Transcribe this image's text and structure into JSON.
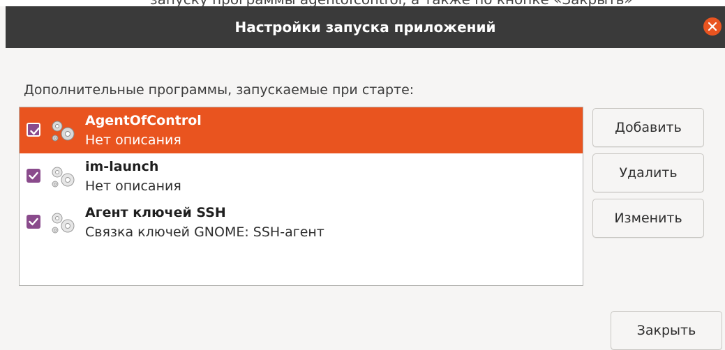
{
  "top_strip_text": "запуску программы agentofcontrol, а также по кнопке «Закрыть»",
  "window": {
    "title": "Настройки запуска приложений",
    "close_icon": "close-icon"
  },
  "section_label": "Дополнительные программы, запускаемые при старте:",
  "startup_items": [
    {
      "name": "AgentOfControl",
      "description": "Нет описания",
      "checked": true,
      "selected": true
    },
    {
      "name": "im-launch",
      "description": "Нет описания",
      "checked": true,
      "selected": false
    },
    {
      "name": "Агент ключей SSH",
      "description": "Связка ключей GNOME: SSH-агент",
      "checked": true,
      "selected": false
    }
  ],
  "buttons": {
    "add": "Добавить",
    "remove": "Удалить",
    "edit": "Изменить",
    "close": "Закрыть"
  },
  "colors": {
    "accent": "#e9541f",
    "checkbox": "#8a4b8c",
    "titlebar": "#3a3a3a"
  }
}
